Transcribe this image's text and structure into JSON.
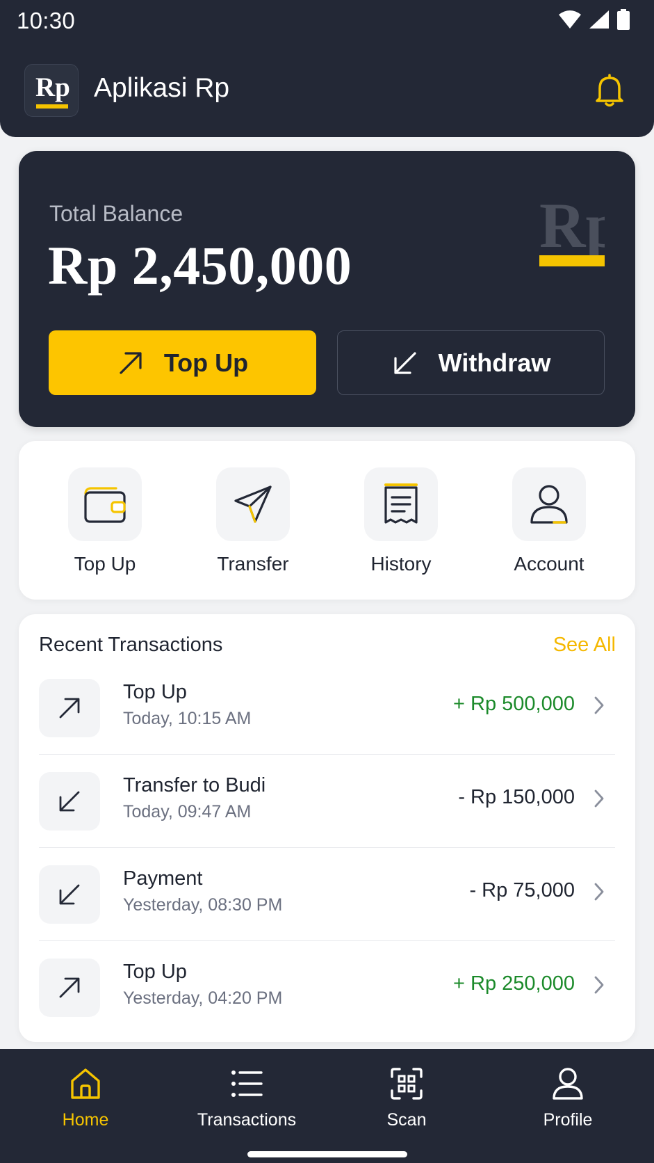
{
  "status_bar": {
    "time": "10:30"
  },
  "header": {
    "logo_text": "Rp",
    "title": "Aplikasi Rp"
  },
  "balance": {
    "label": "Total Balance",
    "value": "Rp 2,450,000",
    "mark_text": "Rp",
    "topup_label": "Top Up",
    "withdraw_label": "Withdraw"
  },
  "quick_actions": [
    {
      "label": "Top Up",
      "icon": "wallet-icon"
    },
    {
      "label": "Transfer",
      "icon": "send-icon"
    },
    {
      "label": "History",
      "icon": "receipt-icon"
    },
    {
      "label": "Account",
      "icon": "user-icon"
    }
  ],
  "recent": {
    "title": "Recent Transactions",
    "see_all": "See All",
    "items": [
      {
        "name": "Top Up",
        "when": "Today, 10:15 AM",
        "amount": "+ Rp 500,000",
        "direction": "in"
      },
      {
        "name": "Transfer to Budi",
        "when": "Today, 09:47 AM",
        "amount": "- Rp 150,000",
        "direction": "out"
      },
      {
        "name": "Payment",
        "when": "Yesterday, 08:30 PM",
        "amount": "- Rp 75,000",
        "direction": "out"
      },
      {
        "name": "Top Up",
        "when": "Yesterday, 04:20 PM",
        "amount": "+ Rp 250,000",
        "direction": "in"
      }
    ]
  },
  "bottom_nav": [
    {
      "label": "Home",
      "icon": "home-icon",
      "active": true
    },
    {
      "label": "Transactions",
      "icon": "list-icon",
      "active": false
    },
    {
      "label": "Scan",
      "icon": "scan-icon",
      "active": false
    },
    {
      "label": "Profile",
      "icon": "profile-icon",
      "active": false
    }
  ],
  "colors": {
    "dark": "#232836",
    "accent": "#fdc500",
    "positive": "#1b8a2a",
    "background": "#f1f2f4"
  }
}
